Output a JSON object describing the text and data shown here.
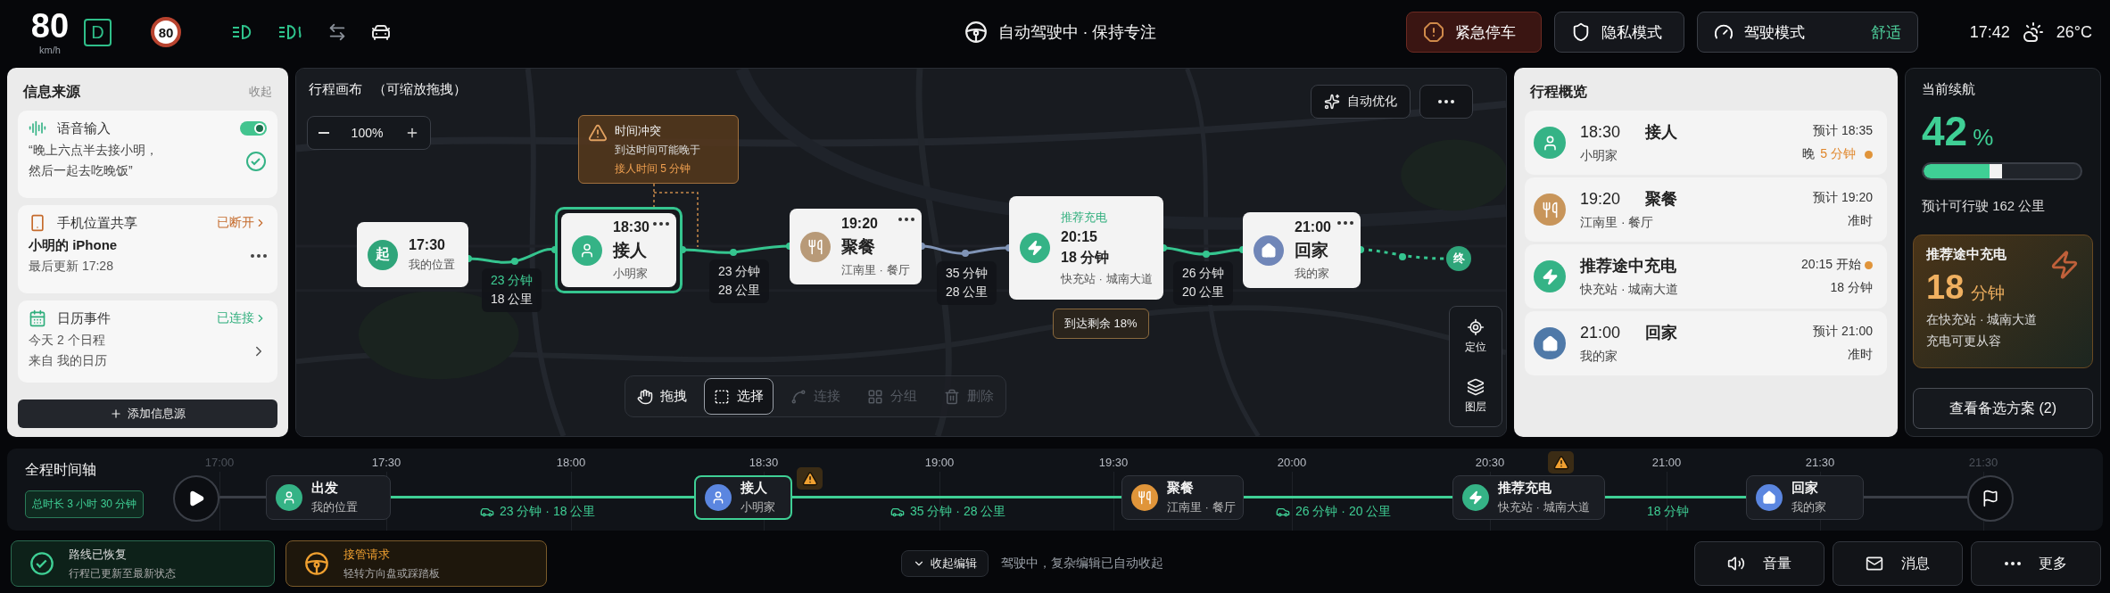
{
  "status_bar": {
    "speed": "80",
    "speed_unit": "km/h",
    "gear": "D",
    "speed_limit": "80",
    "indicators": [
      {
        "kind": "low_beam",
        "on": true
      },
      {
        "kind": "fog",
        "on": true
      },
      {
        "kind": "lane",
        "on": false
      },
      {
        "kind": "car",
        "on": false
      }
    ]
  },
  "center_status": "自动驾驶中 · 保持专注",
  "actions": [
    {
      "kind": "emergency",
      "label": "紧急停车"
    },
    {
      "kind": "privacy",
      "label": "隐私模式"
    },
    {
      "kind": "drive_mode",
      "label": "驾驶模式",
      "value": "舒适"
    }
  ],
  "clock": "17:42",
  "temperature": "26°C",
  "sources": {
    "title": "信息来源",
    "collapse": "收起",
    "items": [
      {
        "kind": "voice",
        "title": "语音输入",
        "on": true,
        "lines": [
          "“晚上六点半去接小明，",
          "然后一起去吃晚饭”"
        ]
      },
      {
        "kind": "phone",
        "title": "手机位置共享",
        "status": "已断开",
        "connected": false,
        "lines": [
          "小明的 iPhone",
          "最后更新 17:28"
        ]
      },
      {
        "kind": "calendar",
        "title": "日历事件",
        "status": "已连接",
        "connected": true,
        "lines": [
          "今天 2 个日程",
          "来自 我的日历"
        ]
      }
    ],
    "add_button": "添加信息源"
  },
  "canvas": {
    "title": "行程画布",
    "hint": "（可缩放拖拽）",
    "zoom": "100%",
    "auto_optimize": "自动优化",
    "conflict": {
      "title": "时间冲突",
      "line": "到达时间可能晚于",
      "highlight": "接人时间 5 分钟"
    },
    "nodes": [
      {
        "kind": "start",
        "badge": "起",
        "time": "17:30",
        "subtitle": "我的位置",
        "selected": false,
        "menu": false
      },
      {
        "kind": "pickup",
        "time": "18:30",
        "title": "接人",
        "subtitle": "小明家",
        "selected": true,
        "menu": true
      },
      {
        "kind": "dining",
        "time": "19:20",
        "title": "聚餐",
        "subtitle": "江南里 · 餐厅",
        "selected": false,
        "menu": true
      },
      {
        "kind": "charge",
        "tag": "推荐充电",
        "time": "20:15",
        "title": "18 分钟",
        "subtitle": "快充站 · 城南大道",
        "selected": false,
        "menu": false
      },
      {
        "kind": "home",
        "time": "21:00",
        "title": "回家",
        "subtitle": "我的家",
        "selected": false,
        "menu": true
      }
    ],
    "legs": [
      {
        "time": "23 分钟",
        "distance": "18 公里",
        "highlight": true
      },
      {
        "time": "23 分钟",
        "distance": "28 公里",
        "highlight": false
      },
      {
        "time": "35 分钟",
        "distance": "28 公里",
        "highlight": false
      },
      {
        "time": "26 分钟",
        "distance": "20 公里",
        "highlight": false
      }
    ],
    "end_label": "终",
    "battery_note": "到达剩余 18%",
    "map_tools": [
      {
        "kind": "locate",
        "label": "定位"
      },
      {
        "kind": "layers",
        "label": "图层"
      }
    ],
    "tools": [
      {
        "kind": "drag",
        "label": "拖拽",
        "selected": false,
        "disabled": false
      },
      {
        "kind": "select",
        "label": "选择",
        "selected": true,
        "disabled": false
      },
      {
        "kind": "connect",
        "label": "连接",
        "selected": false,
        "disabled": true
      },
      {
        "kind": "group",
        "label": "分组",
        "selected": false,
        "disabled": true
      },
      {
        "kind": "delete",
        "label": "删除",
        "selected": false,
        "disabled": true
      }
    ]
  },
  "overview": {
    "title": "行程概览",
    "rows": [
      {
        "kind": "pickup",
        "color": "#35b386",
        "time": "18:30",
        "title": "接人",
        "subtitle": "小明家",
        "eta": "预计 18:35",
        "eta_alert": false,
        "status": "晚",
        "delay": "5 分钟",
        "status_alert": true
      },
      {
        "kind": "dining",
        "color": "#c8955a",
        "time": "19:20",
        "title": "聚餐",
        "subtitle": "江南里 · 餐厅",
        "eta": "预计 19:20",
        "eta_alert": false,
        "status": "准时",
        "status_alert": false
      },
      {
        "kind": "charge",
        "color": "#35b386",
        "title": "推荐途中充电",
        "subtitle": "快充站 · 城南大道",
        "eta": "20:15 开始",
        "eta_alert": true,
        "status": "18 分钟",
        "status_alert": false
      },
      {
        "kind": "home",
        "color": "#4f79a8",
        "time": "21:00",
        "title": "回家",
        "subtitle": "我的家",
        "eta": "预计 21:00",
        "eta_alert": false,
        "status": "准时",
        "status_alert": false
      }
    ]
  },
  "range": {
    "title": "当前续航",
    "percent": "42",
    "unit": "%",
    "level": 0.42,
    "estimate": "预计可行驶 162 公里",
    "charge": {
      "title": "推荐途中充电",
      "value": "18",
      "unit": "分钟",
      "lines": [
        "在快充站 · 城南大道",
        "充电可更从容"
      ]
    },
    "alternatives": "查看备选方案 (2)"
  },
  "timeline": {
    "title": "全程时间轴",
    "total": "总时长 3 小时 30 分钟",
    "ticks": [
      {
        "label": "17:00",
        "dim": true
      },
      {
        "label": "17:30",
        "dim": false
      },
      {
        "label": "18:00",
        "dim": false
      },
      {
        "label": "18:30",
        "dim": false
      },
      {
        "label": "19:00",
        "dim": false
      },
      {
        "label": "19:30",
        "dim": false
      },
      {
        "label": "20:00",
        "dim": false
      },
      {
        "label": "20:30",
        "dim": false
      },
      {
        "label": "21:00",
        "dim": false
      },
      {
        "label": "21:30",
        "dim": false
      },
      {
        "label": "21:30",
        "dim": true
      }
    ],
    "stops": [
      {
        "kind": "start",
        "color": "#35b386",
        "title": "出发",
        "subtitle": "我的位置",
        "selected": false,
        "warning": false
      },
      {
        "kind": "pickup",
        "color": "#5b86e0",
        "title": "接人",
        "subtitle": "小明家",
        "selected": true,
        "warning": true
      },
      {
        "kind": "dining",
        "color": "#e0953a",
        "title": "聚餐",
        "subtitle": "江南里 · 餐厅",
        "selected": false,
        "warning": false
      },
      {
        "kind": "charge",
        "color": "#35b386",
        "title": "推荐充电",
        "subtitle": "快充站 · 城南大道",
        "selected": false,
        "warning": true
      },
      {
        "kind": "home",
        "color": "#5b86e0",
        "title": "回家",
        "subtitle": "我的家",
        "selected": false,
        "warning": false
      }
    ],
    "legs": [
      {
        "kind": "drive",
        "label": "23 分钟 · 18 公里"
      },
      {
        "kind": "drive",
        "label": "35 分钟 · 28 公里"
      },
      {
        "kind": "drive",
        "label": "26 分钟 · 20 公里"
      },
      {
        "kind": "charge",
        "label": "18 分钟"
      }
    ]
  },
  "bottom": {
    "notices": [
      {
        "kind": "success",
        "title": "路线已恢复",
        "text": "行程已更新至最新状态"
      },
      {
        "kind": "warning",
        "title": "接管请求",
        "text": "轻转方向盘或踩踏板"
      }
    ],
    "collapse_edit": "收起编辑",
    "hint": "驾驶中，复杂编辑已自动收起",
    "buttons": [
      {
        "kind": "volume",
        "label": "音量"
      },
      {
        "kind": "message",
        "label": "消息"
      },
      {
        "kind": "more",
        "label": "更多"
      }
    ]
  }
}
